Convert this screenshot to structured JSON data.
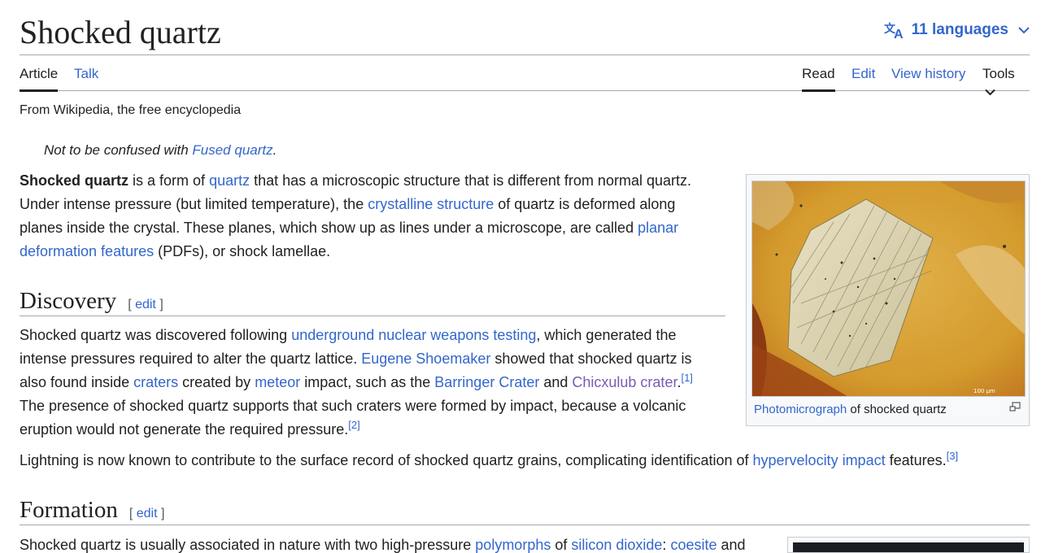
{
  "title": "Shocked quartz",
  "languages": {
    "label": "11 languages"
  },
  "tabs": {
    "article": "Article",
    "talk": "Talk",
    "read": "Read",
    "edit": "Edit",
    "history": "View history",
    "tools": "Tools"
  },
  "tagline": "From Wikipedia, the free encyclopedia",
  "hatnote": {
    "prefix": "Not to be confused with ",
    "link": "Fused quartz",
    "suffix": "."
  },
  "intro": {
    "bold": "Shocked quartz",
    "t1": " is a form of ",
    "l1": "quartz",
    "t2": " that has a microscopic structure that is different from normal quartz.",
    "t3": "Under intense pressure (but limited temperature), the ",
    "l2": "crystalline structure",
    "t4": " of quartz is deformed along",
    "t5": "planes inside the crystal. These planes, which show up as lines under a microscope, are called ",
    "l3": "planar",
    "l3b": "deformation features",
    "t6": " (PDFs), or shock lamellae."
  },
  "discovery": {
    "heading": "Discovery",
    "edit_open": "[ ",
    "edit": "edit",
    "edit_close": " ]",
    "s1": "Shocked quartz was discovered following ",
    "l1": "underground nuclear weapons testing",
    "s2": ", which generated the",
    "s3": "intense pressures required to alter the quartz lattice. ",
    "l2": "Eugene Shoemaker",
    "s4": " showed that shocked quartz is",
    "s5": "also found inside ",
    "l3": "craters",
    "s6": " created by ",
    "l4": "meteor",
    "s7": " impact, such as the ",
    "l5": "Barringer Crater",
    "s8": " and ",
    "l6": "Chicxulub crater",
    "s9": ".",
    "ref1": "[1]",
    "s10": "The presence of shocked quartz supports that such craters were formed by impact, because a volcanic",
    "s11": "eruption would not generate the required pressure.",
    "ref2": "[2]",
    "p2a": "Lightning is now known to contribute to the surface record of shocked quartz grains, complicating identification of ",
    "p2l": "hypervelocity impact",
    "p2b": " features.",
    "ref3": "[3]"
  },
  "figure": {
    "caption_link": "Photomicrograph",
    "caption_text": " of shocked quartz",
    "scale": "100 µm"
  },
  "formation": {
    "heading": "Formation",
    "edit_open": "[ ",
    "edit": "edit",
    "edit_close": " ]",
    "s1": "Shocked quartz is usually associated in nature with two high-pressure ",
    "l1": "polymorphs",
    "s2": " of ",
    "l2": "silicon dioxide",
    "s3": ": ",
    "l3": "coesite",
    "s4": " and"
  },
  "colors": {
    "link": "#3366cc",
    "visited": "#795cb2",
    "text": "#202122",
    "border": "#a2a9b1"
  }
}
